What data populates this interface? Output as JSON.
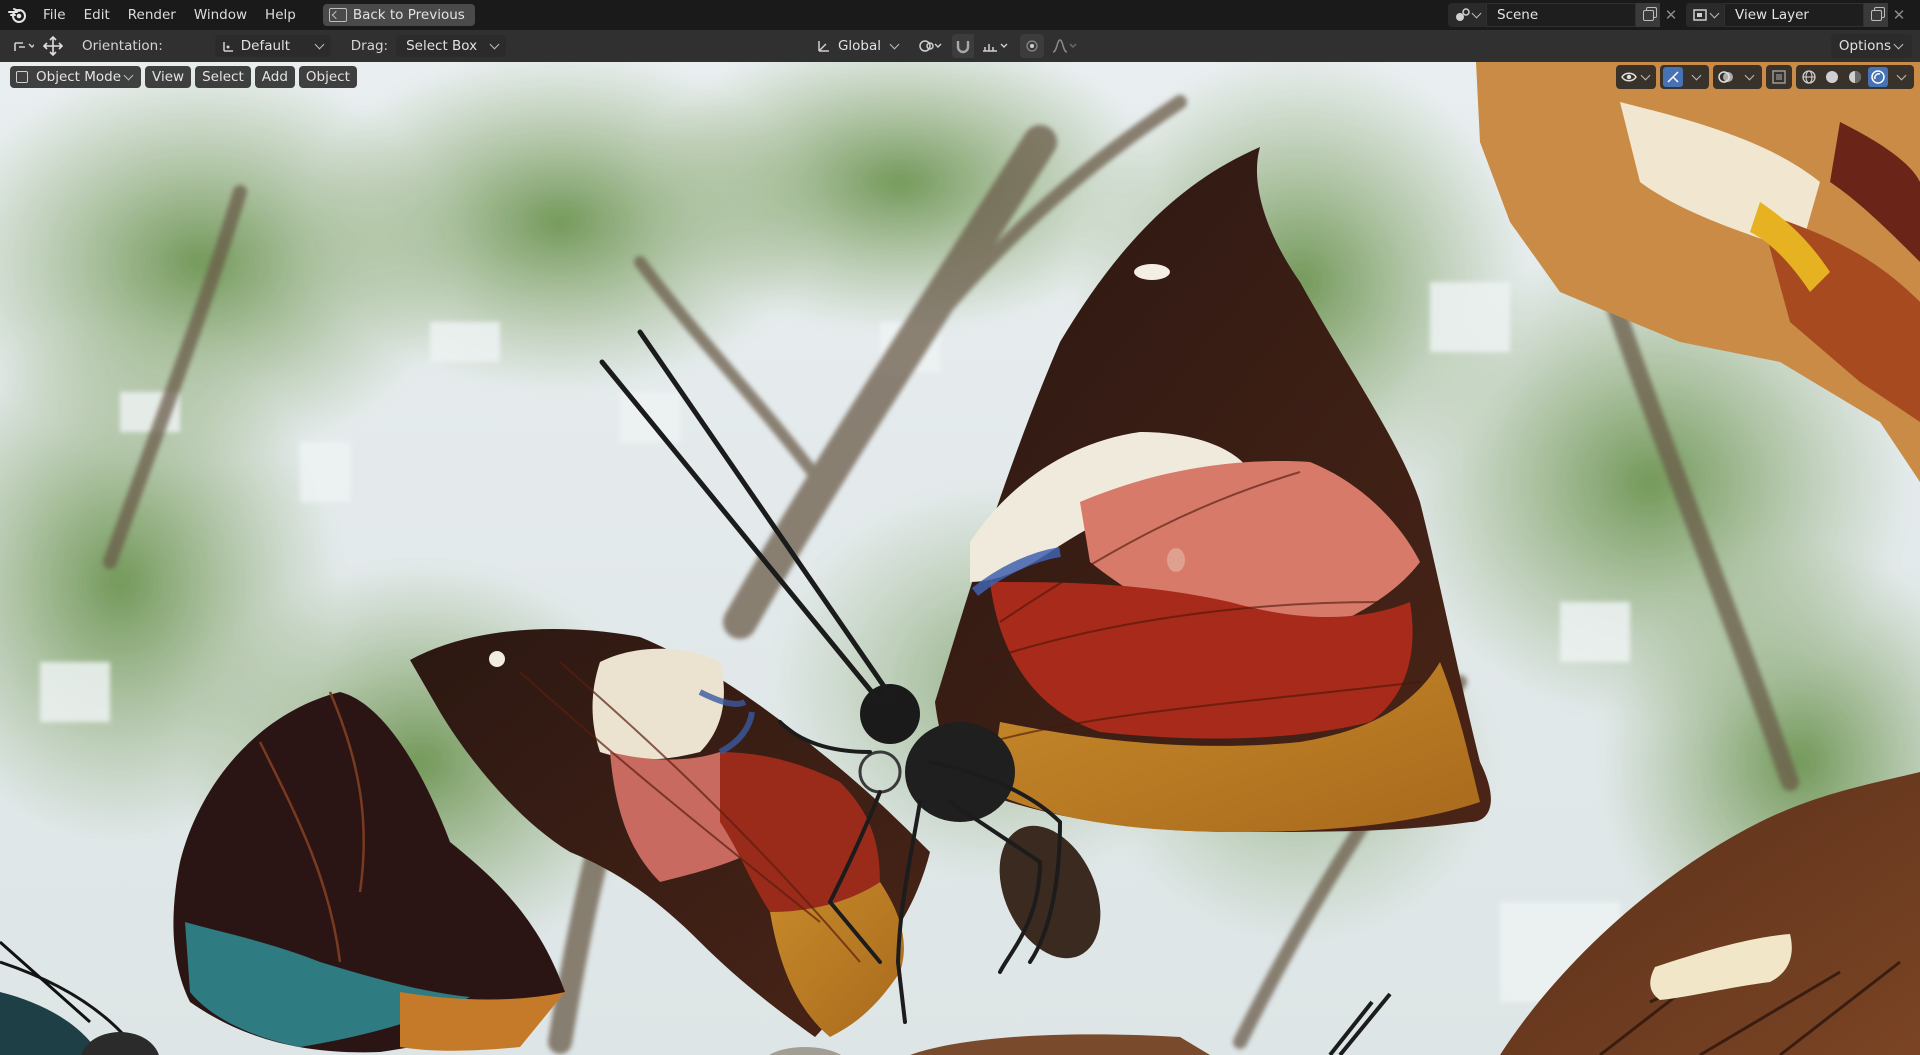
{
  "menubar": {
    "items": [
      "File",
      "Edit",
      "Render",
      "Window",
      "Help"
    ],
    "back_label": "Back to Previous",
    "scene": "Scene",
    "view_layer": "View Layer"
  },
  "toolbar": {
    "orientation_label": "Orientation:",
    "orientation_value": "Default",
    "drag_label": "Drag:",
    "drag_value": "Select Box",
    "transform_orientation": "Global",
    "options_label": "Options"
  },
  "viewport_header": {
    "mode": "Object Mode",
    "menus": [
      "View",
      "Select",
      "Add",
      "Object"
    ]
  },
  "shading": {
    "active_mode": "rendered",
    "accent": "#4772b3"
  },
  "icons": {
    "logo": "blender-logo-icon",
    "transform": "move-icon",
    "snap": "magnet-icon",
    "proportional": "proportional-edit-icon",
    "visibility": "eye-icon",
    "gizmo": "gizmo-icon",
    "overlay": "overlay-icon",
    "xray": "xray-icon",
    "wireframe": "wireframe-icon",
    "solid": "solid-icon",
    "material": "material-icon",
    "rendered": "rendered-icon"
  }
}
